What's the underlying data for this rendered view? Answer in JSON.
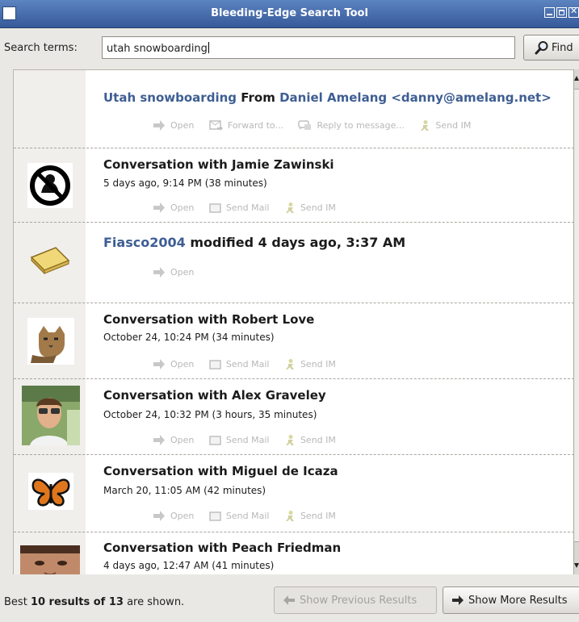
{
  "window": {
    "title": "Bleeding-Edge Search Tool"
  },
  "search": {
    "label": "Search terms:",
    "query": "utah snowboarding",
    "find_label": "Find"
  },
  "results": [
    {
      "type": "email",
      "title": "Utah snowboarding",
      "from_word": "From",
      "sender": "Daniel Amelang <danny@amelang.net>",
      "actions": [
        "Open",
        "Forward to...",
        "Reply to message...",
        "Send IM"
      ]
    },
    {
      "type": "conversation",
      "title": "Conversation with Jamie Zawinski",
      "meta": "5 days ago, 9:14 PM (38 minutes)",
      "actions": [
        "Open",
        "Send Mail",
        "Send IM"
      ]
    },
    {
      "type": "file",
      "title": "Fiasco2004",
      "modified": "modified 4 days ago, 3:37 AM",
      "actions": [
        "Open"
      ]
    },
    {
      "type": "conversation",
      "title": "Conversation with Robert Love",
      "meta": "October 24, 10:24 PM (34 minutes)",
      "actions": [
        "Open",
        "Send Mail",
        "Send IM"
      ]
    },
    {
      "type": "conversation",
      "title": "Conversation with Alex Graveley",
      "meta": "October 24, 10:32 PM (3 hours, 35 minutes)",
      "actions": [
        "Open",
        "Send Mail",
        "Send IM"
      ]
    },
    {
      "type": "conversation",
      "title": "Conversation with Miguel de Icaza",
      "meta": "March 20, 11:05 AM (42 minutes)",
      "actions": [
        "Open",
        "Send Mail",
        "Send IM"
      ]
    },
    {
      "type": "conversation",
      "title": "Conversation with Peach Friedman",
      "meta": "4 days ago, 12:47 AM (41 minutes)"
    }
  ],
  "status": {
    "prefix": "Best",
    "shown_text": "10 results of 13",
    "suffix": "are shown.",
    "prev_label": "Show Previous Results",
    "next_label": "Show More Results"
  },
  "colors": {
    "titlebar": "#4a6fae",
    "link": "#3e5e93",
    "disabled_action": "#b8b8b8"
  }
}
